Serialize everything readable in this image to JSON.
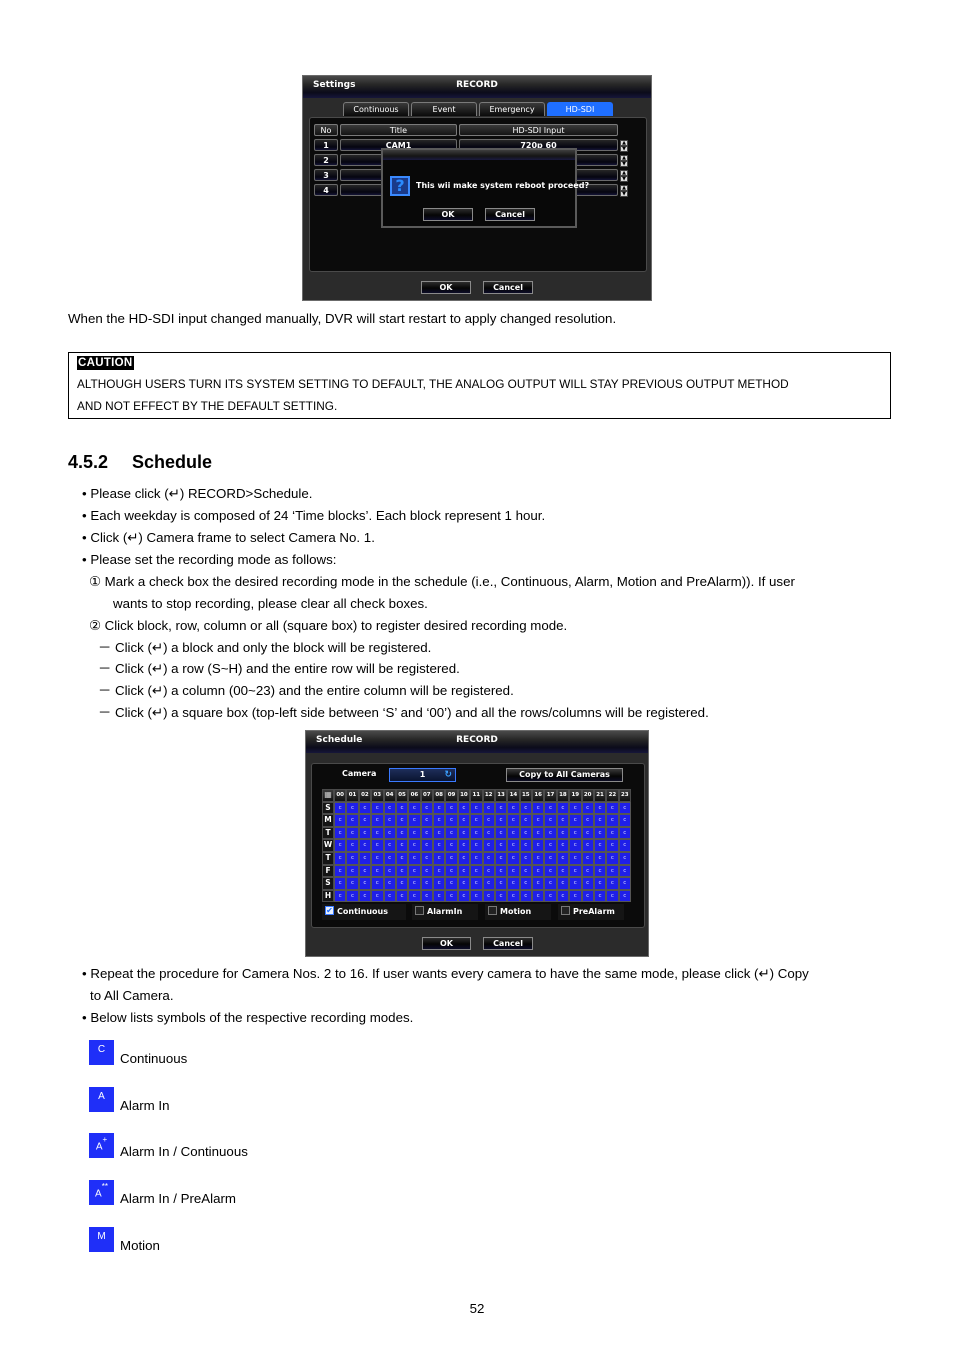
{
  "screenshot_settings": {
    "title_left": "Settings",
    "title_center": "RECORD",
    "tabs": [
      {
        "label": "Continuous",
        "active": false
      },
      {
        "label": "Event",
        "active": false
      },
      {
        "label": "Emergency",
        "active": false
      },
      {
        "label": "HD-SDI",
        "active": true
      }
    ],
    "table": {
      "headers": [
        "No",
        "Title",
        "HD-SDI Input"
      ],
      "rows": [
        {
          "no": "1",
          "title": "CAM1",
          "input": "720p 60"
        },
        {
          "no": "2",
          "title": "",
          "input": ""
        },
        {
          "no": "3",
          "title": "",
          "input": ""
        },
        {
          "no": "4",
          "title": "",
          "input": ""
        }
      ]
    },
    "dialog": {
      "icon": "question-icon",
      "message": "This wii make system reboot proceed?",
      "ok_label": "OK",
      "cancel_label": "Cancel"
    },
    "ok_label": "OK",
    "cancel_label": "Cancel"
  },
  "text": {
    "hdsdi_note": "When the HD-SDI input changed manually, DVR will start restart to apply changed resolution.",
    "caution_label": "CAUTION",
    "caution_line1": "ALTHOUGH USERS TURN ITS SYSTEM SETTING TO DEFAULT, THE ANALOG OUTPUT WILL STAY PREVIOUS OUTPUT METHOD",
    "caution_line2": "AND NOT EFFECT BY THE DEFAULT SETTING.",
    "section_number": "4.5.2",
    "section_title": "Schedule",
    "lines": [
      "• Please click (↵) RECORD>Schedule.",
      "• Each weekday is composed of 24 ‘Time blocks’. Each block represent 1 hour.",
      "• Click (↵) Camera frame to select Camera No. 1.",
      "• Please set the recording mode as follows:",
      "①  Mark a check box the desired recording mode in the schedule (i.e., Continuous, Alarm, Motion and PreAlarm)). If user",
      "wants to stop recording, please clear all check boxes.",
      "②  Click block, row, column or all (square box) to register desired recording mode.",
      "－ Click (↵) a block and only the block will be registered.",
      "－ Click (↵) a row (S~H) and the entire row will be registered.",
      "－ Click (↵) a column (00~23) and the entire column will be registered.",
      "－ Click (↵) a square box (top-left side between ‘S’ and ‘00’) and all the rows/columns will be registered."
    ],
    "after_lines": [
      "• Repeat the procedure for Camera Nos. 2 to 16. If user wants every camera to have the same mode, please click (↵) Copy",
      "to All Camera.",
      "• Below lists symbols of the respective recording modes."
    ],
    "page_number": "52"
  },
  "screenshot_schedule": {
    "title_left": "Schedule",
    "title_center": "RECORD",
    "camera_label": "Camera",
    "camera_value": "1",
    "copy_button": "Copy to All Cameras",
    "corner_icon": "select-all-grid-icon",
    "hours": [
      "00",
      "01",
      "02",
      "03",
      "04",
      "05",
      "06",
      "07",
      "08",
      "09",
      "10",
      "11",
      "12",
      "13",
      "14",
      "15",
      "16",
      "17",
      "18",
      "19",
      "20",
      "21",
      "22",
      "23"
    ],
    "days": [
      "S",
      "M",
      "T",
      "W",
      "T",
      "F",
      "S",
      "H"
    ],
    "cell_symbol": "C",
    "modes": [
      {
        "label": "Continuous",
        "checked": true
      },
      {
        "label": "AlarmIn",
        "checked": false
      },
      {
        "label": "Motion",
        "checked": false
      },
      {
        "label": "PreAlarm",
        "checked": false
      }
    ],
    "ok_label": "OK",
    "cancel_label": "Cancel",
    "cell_color": "#1f1fe8"
  },
  "legend": [
    {
      "symbol": "C",
      "sup": "",
      "label": "Continuous"
    },
    {
      "symbol": "A",
      "sup": "",
      "label": "Alarm In"
    },
    {
      "symbol": "A",
      "sup": "+",
      "label": "Alarm In / Continuous"
    },
    {
      "symbol": "A",
      "sup": "**",
      "label": "Alarm In / PreAlarm"
    },
    {
      "symbol": "M",
      "sup": "",
      "label": "Motion"
    }
  ],
  "colors": {
    "symbol_blue": "#1f2ff8",
    "active_tab": "#1f6fff"
  }
}
